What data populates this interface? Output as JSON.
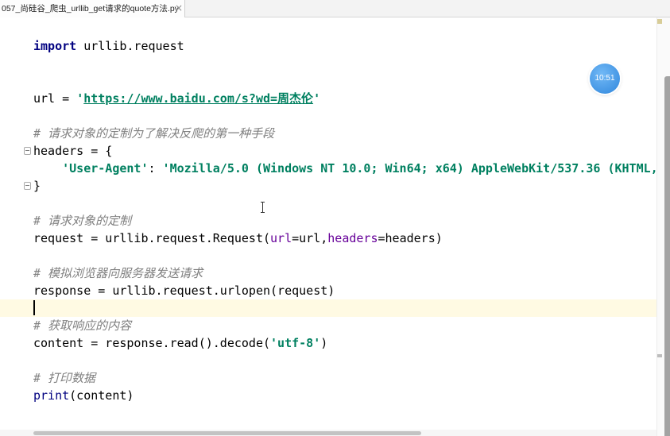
{
  "tab": {
    "filename": "057_尚硅谷_爬虫_urllib_get请求的quote方法.py",
    "close_glyph": "×"
  },
  "clock_overlay": {
    "time": "10:51"
  },
  "editor": {
    "line_import": {
      "keyword": "import",
      "rest": " urllib.request"
    },
    "line_url": {
      "lhs": "url = ",
      "quote_open": "'",
      "link": "https://www.baidu.com/s?wd=周杰伦",
      "quote_close": "'"
    },
    "comment_headers": "# 请求对象的定制为了解决反爬的第一种手段",
    "line_headers_open": "headers = {",
    "line_user_agent": {
      "key": "'User-Agent'",
      "colon": ": ",
      "value": "'Mozilla/5.0 (Windows NT 10.0; Win64; x64) AppleWebKit/537.36 (KHTML,"
    },
    "line_headers_close": "}",
    "comment_request": "# 请求对象的定制",
    "line_request": {
      "head": "request = urllib.request.Request(",
      "param_url": "url",
      "arg_url": "=url,",
      "param_headers": "headers",
      "arg_headers": "=headers)"
    },
    "comment_urlopen": "# 模拟浏览器向服务器发送请求",
    "line_response": "response = urllib.request.urlopen(request)",
    "comment_read": "# 获取响应的内容",
    "line_content": {
      "head": "content = response.read().decode(",
      "encoding": "'utf-8'",
      "tail": ")"
    },
    "comment_print": "# 打印数据",
    "line_print": {
      "builtin": "print",
      "args": "(content)"
    }
  },
  "icons": {
    "tab_close": "close-icon",
    "code_fold": "fold-marker-icon",
    "mouse_pointer": "text-cursor-icon"
  },
  "colors": {
    "keyword": "#000080",
    "string": "#008060",
    "comment": "#808080",
    "param": "#660099",
    "builtin": "#000080",
    "current_line": "#fffae3",
    "clock_badge": "#2f86dc"
  }
}
